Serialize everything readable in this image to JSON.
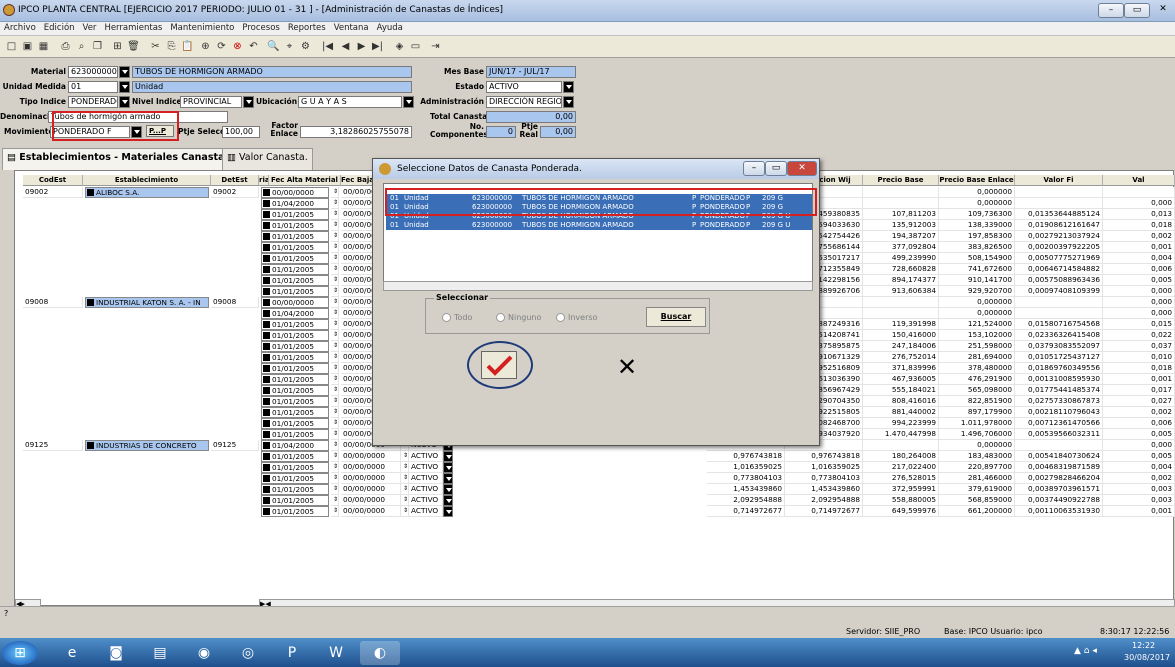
{
  "window": {
    "title": "IPCO PLANTA CENTRAL [EJERCICIO 2017 PERIODO: JULIO 01 - 31 ] - [Administración de Canastas de Índices]"
  },
  "menu": [
    "Archivo",
    "Edición",
    "Ver",
    "Herramientas",
    "Mantenimiento",
    "Procesos",
    "Reportes",
    "Ventana",
    "Ayuda"
  ],
  "form": {
    "material_label": "Material",
    "material_code": "623000000",
    "material_name": "TUBOS DE HORMIGON ARMADO",
    "unidad_label": "Unidad Medida",
    "unidad_code": "01",
    "unidad_name": "Unidad",
    "tipo_label": "Tipo Indice",
    "tipo_value": "PONDERADO",
    "nivel_label": "Nivel Indice",
    "nivel_value": "PROVINCIAL",
    "ubicacion_label": "Ubicación",
    "ubicacion_value": "G U A Y A S",
    "denom_label": "Denominación",
    "denom_value": "Tubos de hormigón armado",
    "mov_label": "Movimiento",
    "mov_value": "PONDERADO F",
    "mov_btn": "P...P",
    "ptje_label": "Ptje Selección",
    "ptje_value": "100,00",
    "factor_label": "Factor Enlace",
    "factor_value": "3,18286025755078",
    "mesbase_label": "Mes Base",
    "mesbase_value": "JUN/17 - JUL/17",
    "estado_label": "Estado",
    "estado_value": "ACTIVO",
    "admin_label": "Administración",
    "admin_value": "DIRECCIÓN REGIO",
    "total_label": "Total Canasta",
    "total_value": "0,00",
    "nocomp_label": "No. Componentes",
    "nocomp_value": "0",
    "ptjereal_label": "Ptje Real",
    "ptjereal_value": "0,00"
  },
  "tabs": {
    "tab1": "Establecimientos - Materiales Canasta.",
    "tab2": "Valor Canasta."
  },
  "grid": {
    "headers": {
      "codest": "CodEst",
      "estab": "Establecimiento",
      "detest": "DetEst",
      "rial": "rial",
      "fecalta": "Fec Alta Material",
      "fecbaja": "Fec Baja M",
      "pond": "nderacion Wij",
      "pbase": "Precio Base",
      "penlace": "Precio Base Enlace",
      "vfi": "Valor Fi",
      "val": "Val"
    },
    "estabs": [
      {
        "code": "09002",
        "name": "ALIBOC S.A.",
        "det": "09002"
      },
      {
        "code": "09008",
        "name": "INDUSTRIAL KATON S. A. - IN",
        "det": "09008"
      },
      {
        "code": "09125",
        "name": "INDUSTRIAS DE CONCRETO",
        "det": "09125"
      }
    ],
    "rows": [
      {
        "alta": "00/00/0000",
        "baja": "00/00/00",
        "est": "",
        "a": "",
        "b": "",
        "c": "",
        "d": "0,000000",
        "e": "",
        "f": ""
      },
      {
        "alta": "01/04/2000",
        "baja": "00/00/00",
        "est": "",
        "a": "",
        "b": "",
        "c": "",
        "d": "0,000000",
        "e": "",
        "f": "0,000"
      },
      {
        "alta": "01/01/2005",
        "baja": "00/00/00",
        "est": "",
        "a": "",
        "b": "1,459380835",
        "c": "107,811203",
        "d": "109,736300",
        "e": "0,01353644885124",
        "f": "0,013"
      },
      {
        "alta": "01/01/2005",
        "baja": "00/00/00",
        "est": "",
        "a": "",
        "b": "2,594033630",
        "c": "135,912003",
        "d": "138,339000",
        "e": "0,01908612161647",
        "f": "0,018"
      },
      {
        "alta": "01/01/2005",
        "baja": "00/00/00",
        "est": "",
        "a": "",
        "b": "0,542754426",
        "c": "194,387207",
        "d": "197,858300",
        "e": "0,00279213037924",
        "f": "0,002"
      },
      {
        "alta": "01/01/2005",
        "baja": "00/00/00",
        "est": "",
        "a": "",
        "b": "0,755686144",
        "c": "377,092804",
        "d": "383,826500",
        "e": "0,00200397922205",
        "f": "0,001"
      },
      {
        "alta": "01/01/2005",
        "baja": "00/00/00",
        "est": "",
        "a": "",
        "b": "2,535017217",
        "c": "499,239990",
        "d": "508,154900",
        "e": "0,00507775271969",
        "f": "0,004"
      },
      {
        "alta": "01/01/2005",
        "baja": "00/00/00",
        "est": "",
        "a": "",
        "b": "4,712355849",
        "c": "728,660828",
        "d": "741,672600",
        "e": "0,00646714584882",
        "f": "0,006"
      },
      {
        "alta": "01/01/2005",
        "baja": "00/00/00",
        "est": "",
        "a": "",
        "b": "5,142298156",
        "c": "894,174377",
        "d": "910,141700",
        "e": "0,00575088963436",
        "f": "0,005"
      },
      {
        "alta": "01/01/2005",
        "baja": "00/00/00",
        "est": "",
        "a": "",
        "b": "0,889926706",
        "c": "913,606384",
        "d": "929,920700",
        "e": "0,00097408109399",
        "f": "0,000"
      },
      {
        "alta": "00/00/0000",
        "baja": "00/00/00",
        "est": "",
        "a": "",
        "b": "",
        "c": "",
        "d": "0,000000",
        "e": "",
        "f": "0,000"
      },
      {
        "alta": "01/04/2000",
        "baja": "00/00/00",
        "est": "",
        "a": "",
        "b": "",
        "c": "",
        "d": "0,000000",
        "e": "",
        "f": "0,000"
      },
      {
        "alta": "01/01/2005",
        "baja": "00/00/00",
        "est": "",
        "a": "",
        "b": "1,887249316",
        "c": "119,391998",
        "d": "121,524000",
        "e": "0,01580716754568",
        "f": "0,015"
      },
      {
        "alta": "01/01/2005",
        "baja": "00/00/00",
        "est": "",
        "a": "",
        "b": "3,514208741",
        "c": "150,416000",
        "d": "153,102000",
        "e": "0,02336326415408",
        "f": "0,022"
      },
      {
        "alta": "01/01/2005",
        "baja": "00/00/00",
        "est": "",
        "a": "",
        "b": "9,375895875",
        "c": "247,184006",
        "d": "251,598000",
        "e": "0,03793083552097",
        "f": "0,037"
      },
      {
        "alta": "01/01/2005",
        "baja": "00/00/00",
        "est": "",
        "a": "",
        "b": "2,910671329",
        "c": "276,752014",
        "d": "281,694000",
        "e": "0,01051725437127",
        "f": "0,010"
      },
      {
        "alta": "01/01/2005",
        "baja": "00/00/00",
        "est": "",
        "a": "",
        "b": "6,952516809",
        "c": "371,839996",
        "d": "378,480000",
        "e": "0,01869760349556",
        "f": "0,018"
      },
      {
        "alta": "01/01/2005",
        "baja": "00/00/00",
        "est": "",
        "a": "",
        "b": "0,613036390",
        "c": "467,936005",
        "d": "476,291900",
        "e": "0,00131008595930",
        "f": "0,001"
      },
      {
        "alta": "01/01/2005",
        "baja": "00/00/0000",
        "est": "ACTIVO",
        "a": "9,856967429",
        "b": "9,856967429",
        "c": "555,184021",
        "d": "565,098000",
        "e": "0,01775441485374",
        "f": "0,017"
      },
      {
        "alta": "01/01/2005",
        "baja": "00/00/0000",
        "est": "ACTIVO",
        "a": "22,290704350",
        "b": "22,290704350",
        "c": "808,416016",
        "d": "822,851900",
        "e": "0,02757330867873",
        "f": "0,027"
      },
      {
        "alta": "01/01/2005",
        "baja": "00/00/0000",
        "est": "ACTIVO",
        "a": "1,922515805",
        "b": "1,922515805",
        "c": "881,440002",
        "d": "897,179900",
        "e": "0,00218110796043",
        "f": "0,002"
      },
      {
        "alta": "01/01/2005",
        "baja": "00/00/0000",
        "est": "ACTIVO",
        "a": "7,082468700",
        "b": "7,082468700",
        "c": "994,223999",
        "d": "1.011,978000",
        "e": "0,00712361470566",
        "f": "0,006"
      },
      {
        "alta": "01/01/2005",
        "baja": "00/00/0000",
        "est": "ACTIVO",
        "a": "7,934037920",
        "b": "7,934037920",
        "c": "1.470,447998",
        "d": "1.496,706000",
        "e": "0,00539566032311",
        "f": "0,005"
      },
      {
        "alta": "01/04/2000",
        "baja": "00/00/0000",
        "est": "NUEVO",
        "a": "",
        "b": "",
        "c": "",
        "d": "0,000000",
        "e": "",
        "f": "0,000"
      },
      {
        "alta": "01/01/2005",
        "baja": "00/00/0000",
        "est": "ACTIVO",
        "a": "0,976743818",
        "b": "0,976743818",
        "c": "180,264008",
        "d": "183,483000",
        "e": "0,00541840730624",
        "f": "0,005"
      },
      {
        "alta": "01/01/2005",
        "baja": "00/00/0000",
        "est": "ACTIVO",
        "a": "1,016359025",
        "b": "1,016359025",
        "c": "217,022400",
        "d": "220,897700",
        "e": "0,00468319871589",
        "f": "0,004"
      },
      {
        "alta": "01/01/2005",
        "baja": "00/00/0000",
        "est": "ACTIVO",
        "a": "0,773804103",
        "b": "0,773804103",
        "c": "276,528015",
        "d": "281,466000",
        "e": "0,00279828466204",
        "f": "0,002"
      },
      {
        "alta": "01/01/2005",
        "baja": "00/00/0000",
        "est": "ACTIVO",
        "a": "1,453439860",
        "b": "1,453439860",
        "c": "372,959991",
        "d": "379,619000",
        "e": "0,00389703961571",
        "f": "0,003"
      },
      {
        "alta": "01/01/2005",
        "baja": "00/00/0000",
        "est": "ACTIVO",
        "a": "2,092954888",
        "b": "2,092954888",
        "c": "558,880005",
        "d": "568,859000",
        "e": "0,00374490922788",
        "f": "0,003"
      },
      {
        "alta": "01/01/2005",
        "baja": "00/00/0000",
        "est": "ACTIVO",
        "a": "0,714972677",
        "b": "0,714972677",
        "c": "649,599976",
        "d": "661,200000",
        "e": "0,00110063531930",
        "f": "0,001"
      }
    ]
  },
  "dialog": {
    "title": "Seleccione Datos de Canasta Ponderada.",
    "rows": [
      {
        "um": "01",
        "desc": "Unidad",
        "code": "623000000",
        "mat": "TUBOS DE HORMIGON ARMADO",
        "p": "P",
        "tipo": "PONDERADO",
        "n": "P",
        "u": "209 G"
      },
      {
        "um": "01",
        "desc": "Unidad",
        "code": "623000000",
        "mat": "TUBOS DE HORMIGON ARMADO",
        "p": "P",
        "tipo": "PONDERADO",
        "n": "P",
        "u": "209 G"
      },
      {
        "um": "01",
        "desc": "Unidad",
        "code": "623000000",
        "mat": "TUBOS DE HORMIGON ARMADO",
        "p": "P",
        "tipo": "PONDERADO",
        "n": "P",
        "u": "209 G U"
      },
      {
        "um": "01",
        "desc": "Unidad",
        "code": "623000000",
        "mat": "TUBOS DE HORMIGON ARMADO",
        "p": "P",
        "tipo": "PONDERADO",
        "n": "P",
        "u": "209 G U"
      }
    ],
    "sel_legend": "Seleccionar",
    "r_todo": "Todo",
    "r_ninguno": "Ninguno",
    "r_inverso": "Inverso",
    "buscar": "Buscar"
  },
  "status": {
    "servidor": "Servidor: SIIE_PRO",
    "base": "Base: IPCO Usuario: ipco",
    "time": "8:30:17 12:22:56"
  },
  "taskbar": {
    "clock_time": "12:22",
    "clock_date": "30/08/2017"
  }
}
